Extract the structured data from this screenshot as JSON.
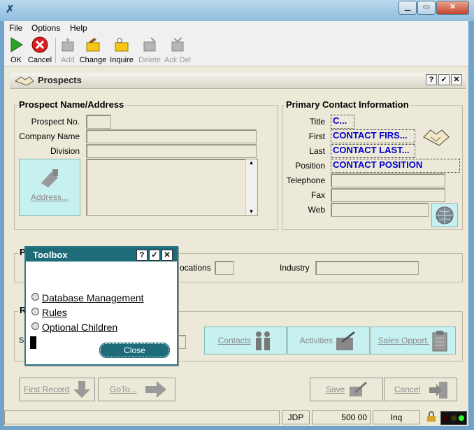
{
  "menu": [
    "File",
    "Options",
    "Help"
  ],
  "toolbar": {
    "ok": "OK",
    "cancel": "Cancel",
    "add": "Add",
    "change": "Change",
    "inquire": "Inquire",
    "delete": "Delete",
    "ack_del": "Ack Del"
  },
  "inner": {
    "title": "Prospects",
    "buttons": [
      "?",
      "✓",
      "✕"
    ]
  },
  "prospect": {
    "group_title": "Prospect Name/Address",
    "prospect_no_label": "Prospect No.",
    "company_label": "Company Name",
    "division_label": "Division",
    "address_button": "Address..."
  },
  "contact": {
    "group_title": "Primary Contact Information",
    "title_label": "Title",
    "title_value": "C...",
    "first_label": "First",
    "first_value": "CONTACT FIRS...",
    "last_label": "Last",
    "last_value": "CONTACT LAST...",
    "position_label": "Position",
    "position_value": "CONTACT POSITION",
    "telephone_label": "Telephone",
    "fax_label": "Fax",
    "web_label": "Web"
  },
  "middle": {
    "group_initial": "P",
    "locations_label": "ocations",
    "industry_label": "Industry"
  },
  "lower": {
    "group_initial": "R",
    "side_initial": "S",
    "contacts": "Contacts",
    "activities": "Activities",
    "sales_opport": "Sales Opport."
  },
  "nav": {
    "first_record": "First Record",
    "goto": "GoTo...",
    "save": "Save",
    "cancel": "Cancel"
  },
  "status": {
    "user": "JDP",
    "value": "500 00",
    "mode": "Inq"
  },
  "toolbox": {
    "title": "Toolbox",
    "buttons": [
      "?",
      "✓",
      "✕"
    ],
    "options": [
      "Database Management",
      "Rules",
      "Optional Children"
    ],
    "close": "Close"
  },
  "colors": {
    "accent": "#1e6b7a",
    "contact_text": "#0000cc",
    "button_face": "#c7f0f0"
  }
}
